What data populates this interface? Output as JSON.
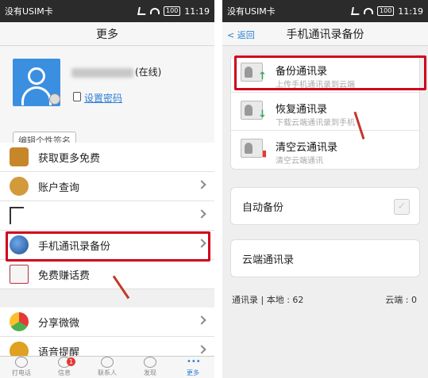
{
  "left": {
    "status": {
      "carrier": "没有USIM卡",
      "battery": "100",
      "time": "11:19"
    },
    "title": "更多",
    "profile": {
      "status": "(在线)",
      "set_password": "设置密码",
      "signature_button": "编辑个性签名"
    },
    "menu": [
      {
        "label": "获取更多免费",
        "icon": "treasure-chest-icon",
        "color": "#c8862a"
      },
      {
        "label": "账户查询",
        "icon": "money-bag-icon",
        "color": "#d39a3c"
      },
      {
        "label": "",
        "icon": "blank-icon",
        "color": "#ffffff"
      },
      {
        "label": "手机通讯录备份",
        "icon": "globe-icon",
        "color": "#2a5fa8"
      },
      {
        "label": "免费赚话费",
        "icon": "pen-note-icon",
        "color": "#b0303a"
      },
      {
        "label": "分享微微",
        "icon": "share-icon",
        "color": "#4caf50"
      },
      {
        "label": "语音提醒",
        "icon": "bell-icon",
        "color": "#e0a020"
      }
    ],
    "tabs": [
      {
        "label": "打电话",
        "icon": "dialpad-icon"
      },
      {
        "label": "信息",
        "icon": "message-icon",
        "badge": "1"
      },
      {
        "label": "联系人",
        "icon": "contacts-icon"
      },
      {
        "label": "发现",
        "icon": "compass-icon"
      },
      {
        "label": "更多",
        "icon": "more-icon",
        "glyph": "•••"
      }
    ],
    "highlight_color": "#d0021b"
  },
  "right": {
    "status": {
      "carrier": "没有USIM卡",
      "battery": "100",
      "time": "11:19"
    },
    "back_label": "< 返回",
    "title": "手机通讯录备份",
    "actions": [
      {
        "title": "备份通讯录",
        "subtitle": "上传手机通讯录到云端",
        "icon": "backup-up-icon",
        "mark": "↑",
        "mark_color": "#3aa655"
      },
      {
        "title": "恢复通讯录",
        "subtitle": "下载云端通讯录到手机",
        "icon": "restore-down-icon",
        "mark": "↓",
        "mark_color": "#3aa655"
      },
      {
        "title": "清空云通讯录",
        "subtitle": "清空云端通讯",
        "icon": "clear-trash-icon",
        "mark": "▮",
        "mark_color": "#e53935"
      }
    ],
    "auto_backup_label": "自动备份",
    "cloud_contacts_label": "云端通讯录",
    "footer_local": "通讯录 | 本地 : 62",
    "footer_cloud": "云端 : 0"
  }
}
